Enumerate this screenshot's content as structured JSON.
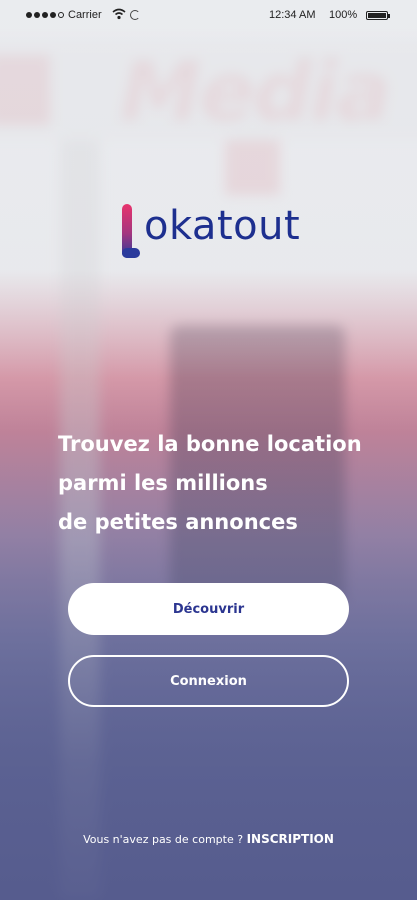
{
  "status_bar": {
    "carrier": "Carrier",
    "time": "12:34 AM",
    "battery": "100%"
  },
  "logo": {
    "initial": "L",
    "rest": "okatout"
  },
  "headline": {
    "lines": [
      "Trouvez la bonne location",
      "parmi les millions",
      "de petites annonces"
    ]
  },
  "buttons": {
    "discover_label": "Découvrir",
    "login_label": "Connexion"
  },
  "footer": {
    "prompt": "Vous n'avez pas de compte ?",
    "signup_label": "INSCRIPTION"
  },
  "colors": {
    "brand_blue": "#1d2f8f",
    "brand_pink": "#e8336d",
    "button_text": "#2b3590"
  }
}
